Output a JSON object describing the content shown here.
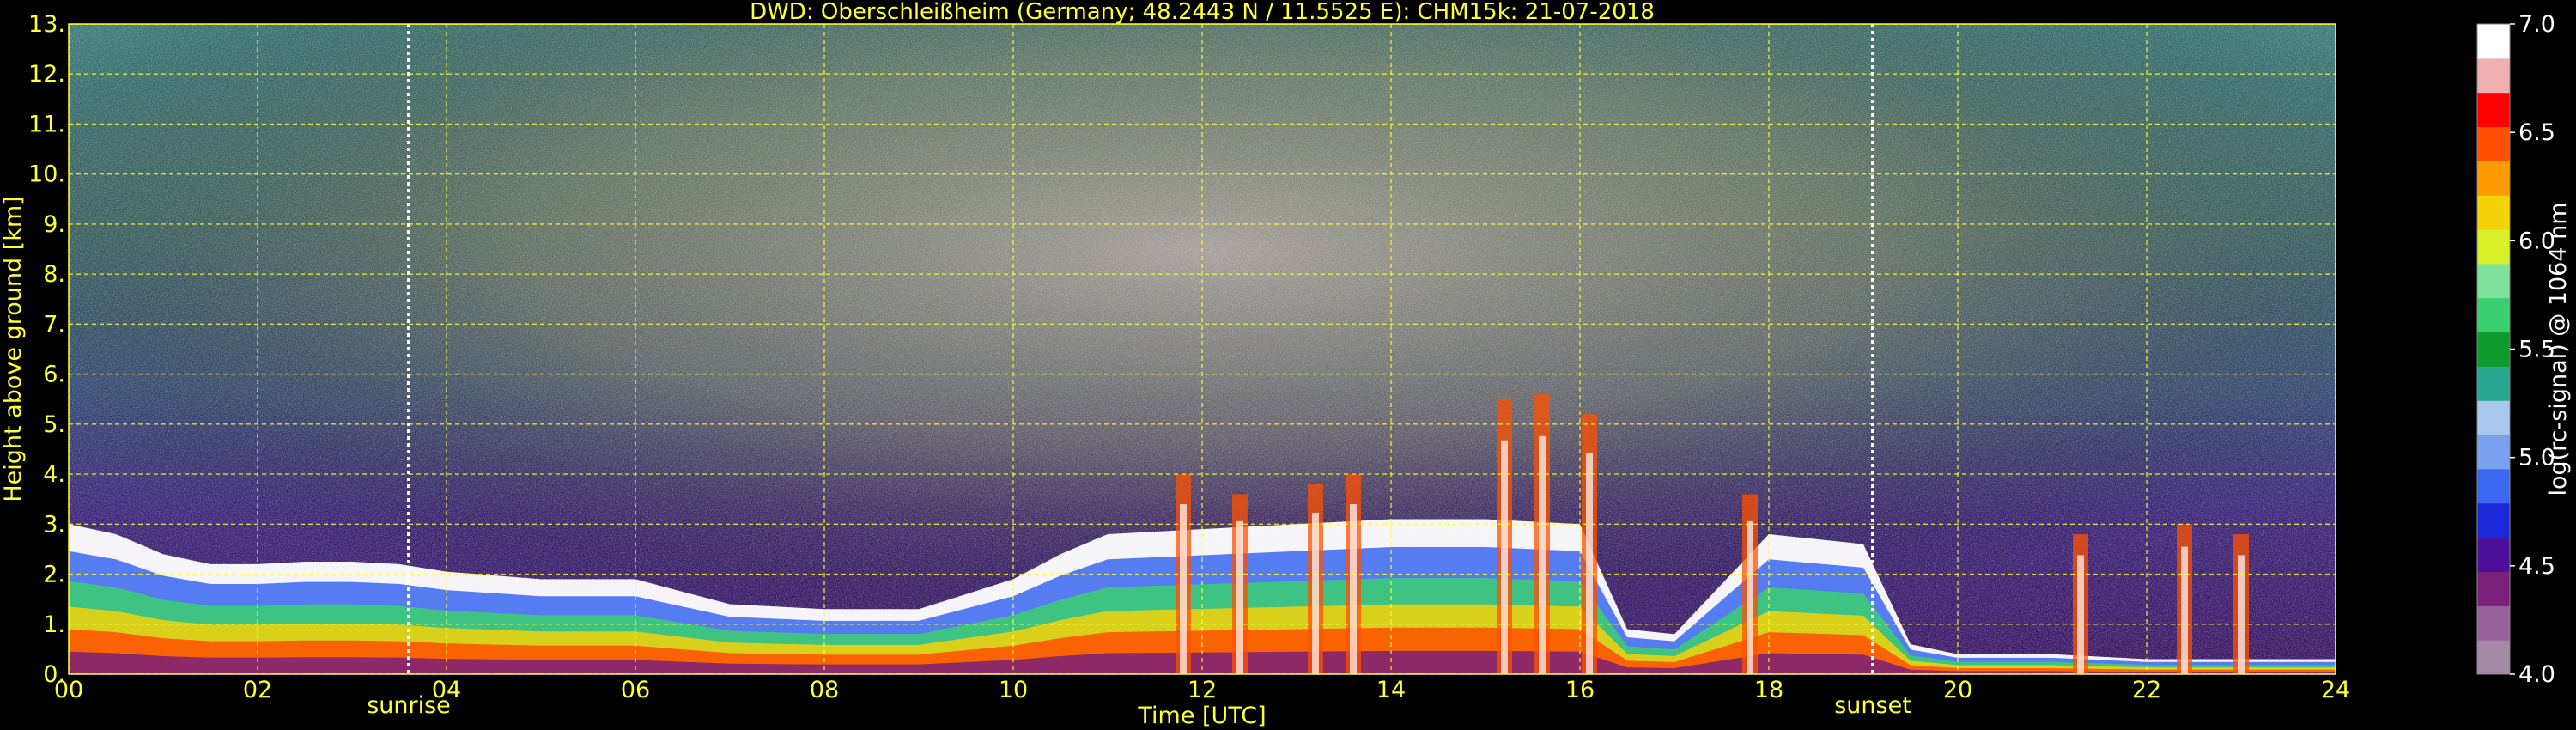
{
  "chart_data": {
    "type": "heatmap",
    "title": "DWD: Oberschleißheim (Germany; 48.2443 N / 11.5525 E):    CHM15k: 21-07-2018",
    "xlabel": "Time [UTC]",
    "ylabel": "Height above ground [km]",
    "xlim": [
      0,
      24
    ],
    "ylim": [
      0,
      13
    ],
    "x_ticks": [
      "00",
      "02",
      "04",
      "06",
      "08",
      "10",
      "12",
      "14",
      "16",
      "18",
      "20",
      "22",
      "24"
    ],
    "y_ticks": [
      "0.",
      "1.",
      "2.",
      "3.",
      "4.",
      "5.",
      "6.",
      "7.",
      "8.",
      "9.",
      "10.",
      "11.",
      "12.",
      "13."
    ],
    "grid": true,
    "colorbar": {
      "label": "log(rc-signal) @ 1064 nm",
      "range": [
        4.0,
        7.0
      ],
      "ticks": [
        "4.0",
        "4.5",
        "5.0",
        "5.5",
        "6.0",
        "6.5",
        "7.0"
      ]
    },
    "annotations": [
      {
        "text": "sunrise",
        "x": 3.6
      },
      {
        "text": "sunset",
        "x": 19.1
      }
    ],
    "colors": {
      "text": "#ffff33",
      "grid": "#ffff33",
      "background": "#000000",
      "sun_lines": "#ffffff"
    },
    "colorscale": [
      "#a58aa5",
      "#96619b",
      "#7a1f7a",
      "#4b0f9a",
      "#1b28d8",
      "#3a66f0",
      "#7aa0f0",
      "#a8c8f0",
      "#2aa590",
      "#0c9a2c",
      "#3ad070",
      "#7fe29a",
      "#d8f02a",
      "#f5d20a",
      "#ff9a00",
      "#ff5000",
      "#ff0000",
      "#f0b0b0",
      "#ffffff"
    ],
    "boundary_layer_top_km": [
      [
        0,
        3.0
      ],
      [
        0.5,
        2.8
      ],
      [
        1,
        2.4
      ],
      [
        1.5,
        2.2
      ],
      [
        2,
        2.2
      ],
      [
        2.5,
        2.25
      ],
      [
        3,
        2.25
      ],
      [
        3.5,
        2.2
      ],
      [
        4,
        2.05
      ],
      [
        5,
        1.9
      ],
      [
        6,
        1.9
      ],
      [
        7,
        1.4
      ],
      [
        8,
        1.3
      ],
      [
        9,
        1.3
      ],
      [
        10,
        1.9
      ],
      [
        10.5,
        2.4
      ],
      [
        11,
        2.8
      ],
      [
        12,
        2.9
      ],
      [
        13,
        3.0
      ],
      [
        14,
        3.1
      ],
      [
        15,
        3.1
      ],
      [
        16,
        3.0
      ],
      [
        16.5,
        0.9
      ],
      [
        17,
        0.8
      ],
      [
        17.5,
        1.8
      ],
      [
        18,
        2.8
      ],
      [
        18.5,
        2.7
      ],
      [
        19,
        2.6
      ],
      [
        19.5,
        0.6
      ],
      [
        20,
        0.4
      ],
      [
        21,
        0.4
      ],
      [
        22,
        0.3
      ],
      [
        23,
        0.3
      ],
      [
        24,
        0.3
      ]
    ]
  }
}
